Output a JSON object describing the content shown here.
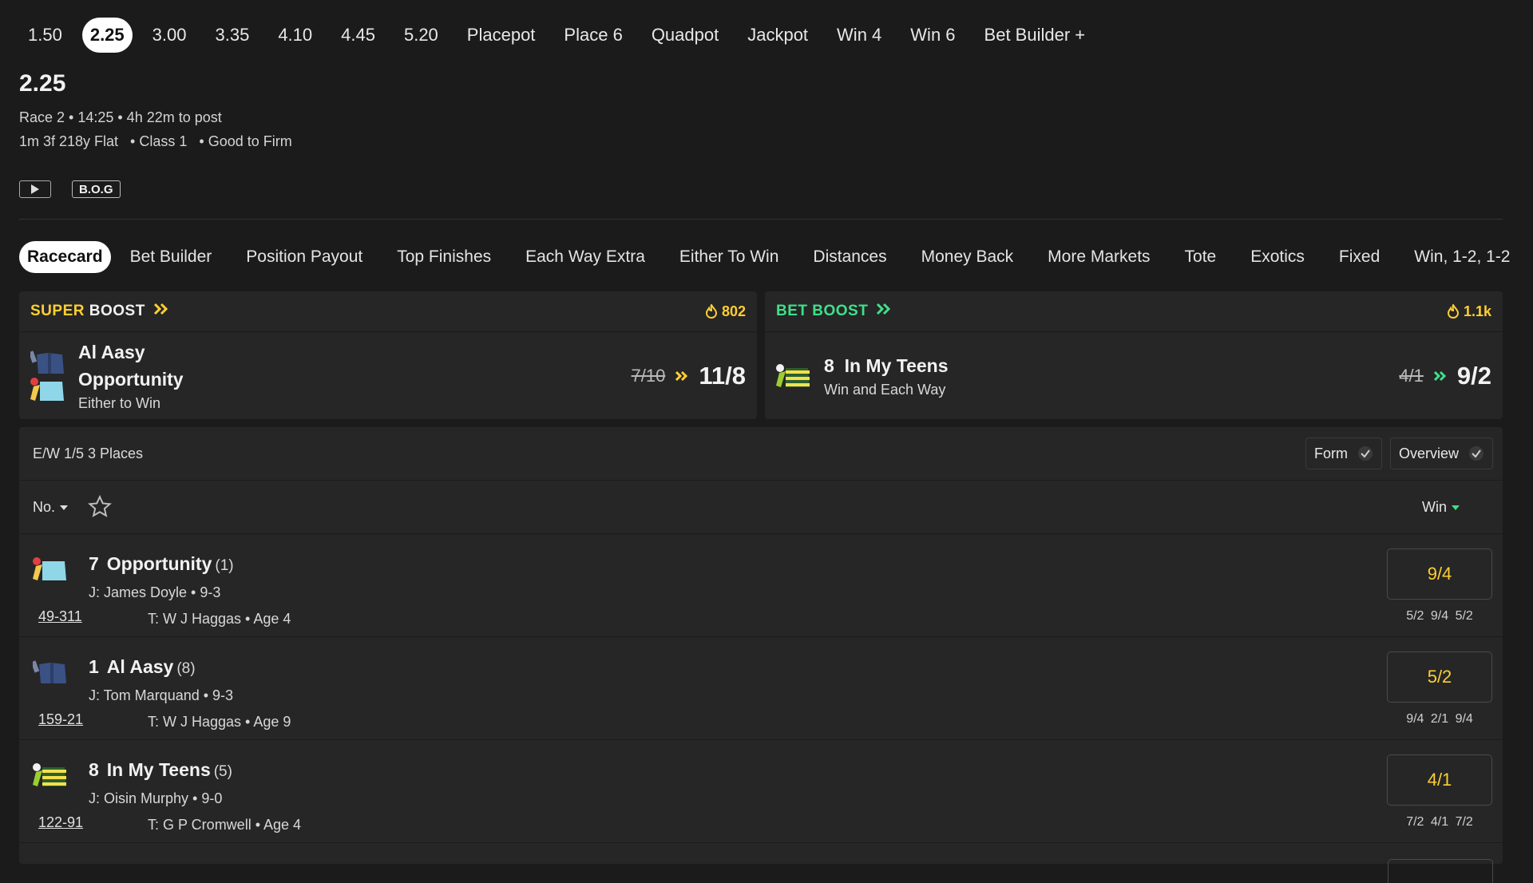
{
  "race_tabs": [
    {
      "label": "1.50",
      "active": false
    },
    {
      "label": "2.25",
      "active": true
    },
    {
      "label": "3.00",
      "active": false
    },
    {
      "label": "3.35",
      "active": false
    },
    {
      "label": "4.10",
      "active": false
    },
    {
      "label": "4.45",
      "active": false
    },
    {
      "label": "5.20",
      "active": false
    },
    {
      "label": "Placepot",
      "active": false
    },
    {
      "label": "Place 6",
      "active": false
    },
    {
      "label": "Quadpot",
      "active": false
    },
    {
      "label": "Jackpot",
      "active": false
    },
    {
      "label": "Win 4",
      "active": false
    },
    {
      "label": "Win 6",
      "active": false
    },
    {
      "label": "Bet Builder +",
      "active": false
    }
  ],
  "race": {
    "title": "2.25",
    "line1": "Race 2 • 14:25 • 4h 22m to post",
    "line2": "1m 3f 218y Flat   • Class 1   • Good to Firm",
    "bog_label": "B.O.G"
  },
  "market_tabs": [
    "Racecard",
    "Bet Builder",
    "Position Payout",
    "Top Finishes",
    "Each Way Extra",
    "Either To Win",
    "Distances",
    "Money Back",
    "More Markets",
    "Tote",
    "Exotics",
    "Fixed",
    "Win, 1-2, 1-2"
  ],
  "super_boost": {
    "label_a": "SUPER",
    "label_b": "BOOST",
    "count": "802",
    "name1": "Al Aasy",
    "name2": "Opportunity",
    "subtitle": "Either to Win",
    "old_odds": "7/10",
    "new_odds": "11/8"
  },
  "bet_boost": {
    "label": "BET BOOST",
    "count": "1.1k",
    "number": "8",
    "name": "In My Teens",
    "subtitle": "Win and Each Way",
    "old_odds": "4/1",
    "new_odds": "9/2"
  },
  "card": {
    "ew_terms": "E/W 1/5 3 Places",
    "toggle_form": "Form",
    "toggle_overview": "Overview",
    "sort_no": "No.",
    "sort_win": "Win"
  },
  "runners": [
    {
      "number": "7",
      "name": "Opportunity",
      "draw": "(1)",
      "jockey": "J: James Doyle • 9-3",
      "form": "49-311",
      "trainer": "T: W J Haggas • Age 4",
      "price": "9/4",
      "prev": "5/2 9/4 5/2",
      "silk": "red-cyan"
    },
    {
      "number": "1",
      "name": "Al Aasy",
      "draw": "(8)",
      "jockey": "J: Tom Marquand • 9-3",
      "form": "159-21",
      "trainer": "T: W J Haggas • Age 9",
      "price": "5/2",
      "prev": "9/4 2/1 9/4",
      "silk": "navy"
    },
    {
      "number": "8",
      "name": "In My Teens",
      "draw": "(5)",
      "jockey": "J: Oisin Murphy • 9-0",
      "form": "122-91",
      "trainer": "T: G P Cromwell • Age 4",
      "price": "4/1",
      "prev": "7/2 4/1 7/2",
      "silk": "stripes"
    }
  ],
  "colors": {
    "accent_yellow": "#ffcf33",
    "accent_green": "#3fe08a",
    "bg": "#1b1b1b",
    "panel": "#262626"
  }
}
